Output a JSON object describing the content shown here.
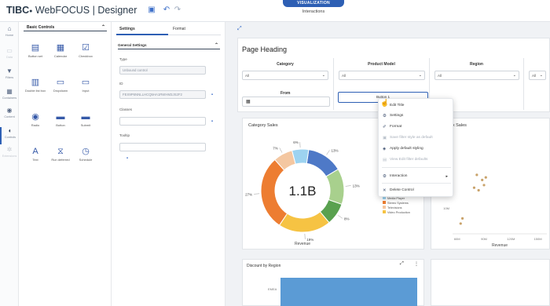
{
  "app": {
    "brand_tibco": "TIBC",
    "brand_o": "●",
    "brand_webfocus": "WebFOCUS",
    "brand_sep": " | ",
    "brand_designer": "Designer",
    "save_icon": "save-icon",
    "undo_icon": "undo-icon",
    "redo_icon": "redo-icon",
    "mode_pill": "VISUALIZATION",
    "mode_sub": "Interactions"
  },
  "leftnav": [
    {
      "icon": "home-icon",
      "glyph": "⌂",
      "label": "Home"
    },
    {
      "icon": "data-icon",
      "glyph": "▭",
      "label": "Data"
    },
    {
      "icon": "filter-icon",
      "glyph": "▼",
      "label": "Filters"
    },
    {
      "icon": "containers-icon",
      "glyph": "▦",
      "label": "Containers"
    },
    {
      "icon": "globe-icon",
      "glyph": "◉",
      "label": "Content"
    },
    {
      "icon": "controls-icon",
      "glyph": "◐",
      "label": "Controls"
    },
    {
      "icon": "extensions-icon",
      "glyph": "✲",
      "label": "Extensions"
    }
  ],
  "basic_controls": {
    "title": "Basic Controls",
    "items": [
      {
        "icon": "button-set-icon",
        "glyph": "▤",
        "label": "Button set"
      },
      {
        "icon": "calendar-icon",
        "glyph": "▦",
        "label": "Calendar"
      },
      {
        "icon": "checkbox-icon",
        "glyph": "☑",
        "label": "Checkbox"
      },
      {
        "icon": "double-list-box-icon",
        "glyph": "▥",
        "label": "Double list box"
      },
      {
        "icon": "dropdown-icon",
        "glyph": "▭",
        "label": "Dropdown"
      },
      {
        "icon": "input-icon",
        "glyph": "▭",
        "label": "Input"
      },
      {
        "icon": "radio-icon",
        "glyph": "◉",
        "label": "Radio"
      },
      {
        "icon": "button-icon",
        "glyph": "▬",
        "label": "Button"
      },
      {
        "icon": "submit-icon",
        "glyph": "▬",
        "label": "Submit"
      },
      {
        "icon": "text-icon",
        "glyph": "A",
        "label": "Text"
      },
      {
        "icon": "run-deferred-icon",
        "glyph": "⧖",
        "label": "Run deferred"
      },
      {
        "icon": "schedule-icon",
        "glyph": "◷",
        "label": "Schedule"
      }
    ]
  },
  "settings": {
    "tab_settings": "Settings",
    "tab_format": "Format",
    "section_title": "General Settings",
    "type_label": "Type",
    "type_value": "Unbound control",
    "id_label": "ID",
    "id_value": "FEX9P6NNLLHCQ5HA1RWHM3JS2F2",
    "classes_label": "Classes",
    "classes_value": "",
    "tooltip_label": "Tooltip",
    "tooltip_value": ""
  },
  "canvas": {
    "page_heading": "Page Heading",
    "filters": [
      {
        "name": "Category",
        "value": "All"
      },
      {
        "name": "Product Model",
        "value": "All"
      },
      {
        "name": "Region",
        "value": "All"
      },
      {
        "name": "",
        "value": "All"
      }
    ],
    "from_label": "From",
    "button_label": "Button 1"
  },
  "context_menu": {
    "items": [
      {
        "icon": "edit-title-icon",
        "glyph": "✎",
        "label": "Edit Title",
        "disabled": false
      },
      {
        "icon": "settings-icon",
        "glyph": "⚙",
        "label": "Settings",
        "disabled": false
      },
      {
        "icon": "format-icon",
        "glyph": "✐",
        "label": "Format",
        "disabled": false
      },
      {
        "icon": "save-filter-style-icon",
        "glyph": "▣",
        "label": "Save filter style as default",
        "disabled": true
      },
      {
        "icon": "apply-styling-icon",
        "glyph": "◈",
        "label": "Apply default styling",
        "disabled": false
      },
      {
        "icon": "view-defaults-icon",
        "glyph": "▤",
        "label": "View Edit filter defaults",
        "disabled": true
      },
      {
        "icon": "interaction-icon",
        "glyph": "⚙",
        "label": "Interaction",
        "disabled": false,
        "submenu": "▸"
      },
      {
        "icon": "delete-icon",
        "glyph": "✕",
        "label": "Delete Control",
        "disabled": false
      }
    ]
  },
  "category_sales": {
    "title": "Category Sales",
    "center_value": "1.1B",
    "xaxis_label": "Revenue",
    "legend": [
      "Media Player",
      "Stereo Systems",
      "Televisions",
      "Video Production"
    ]
  },
  "right_chart": {
    "title": "Cost x Sales",
    "xlabel": "Revenue",
    "ticks_y": [
      "20M",
      "10M"
    ],
    "ticks_x": [
      "60M",
      "90M",
      "120M",
      "150M"
    ]
  },
  "discount": {
    "title": "Discount by Region",
    "bar_label": "EMEA"
  },
  "chart_data": [
    {
      "type": "pie",
      "title": "Category Sales",
      "slices": [
        {
          "label": "Media Player",
          "value": 13,
          "color": "#4e79c7"
        },
        {
          "label": "Stereo Systems",
          "value": 13,
          "color": "#a8d08d"
        },
        {
          "label": "",
          "value": 8,
          "color": "#59a14f"
        },
        {
          "label": "Televisions",
          "value": 19,
          "color": "#f6c343"
        },
        {
          "label": "Video Production",
          "value": 27,
          "color": "#ed7d31"
        },
        {
          "label": "",
          "value": 7,
          "color": "#f4c7a1"
        },
        {
          "label": "",
          "value": 6,
          "color": "#9dd3f0"
        }
      ],
      "percent_labels": [
        "13%",
        "13%",
        "8%",
        "19%",
        "27%",
        "7%",
        "6%"
      ]
    },
    {
      "type": "scatter",
      "title": "Cost x Sales",
      "xlabel": "Revenue",
      "points": [
        {
          "x": 88,
          "y": 21
        },
        {
          "x": 82,
          "y": 23
        },
        {
          "x": 79,
          "y": 18
        },
        {
          "x": 84,
          "y": 17
        },
        {
          "x": 90,
          "y": 19
        },
        {
          "x": 92,
          "y": 22
        },
        {
          "x": 66,
          "y": 6
        },
        {
          "x": 64,
          "y": 4
        }
      ],
      "xlim": [
        55,
        160
      ],
      "ylim": [
        0,
        30
      ]
    }
  ]
}
